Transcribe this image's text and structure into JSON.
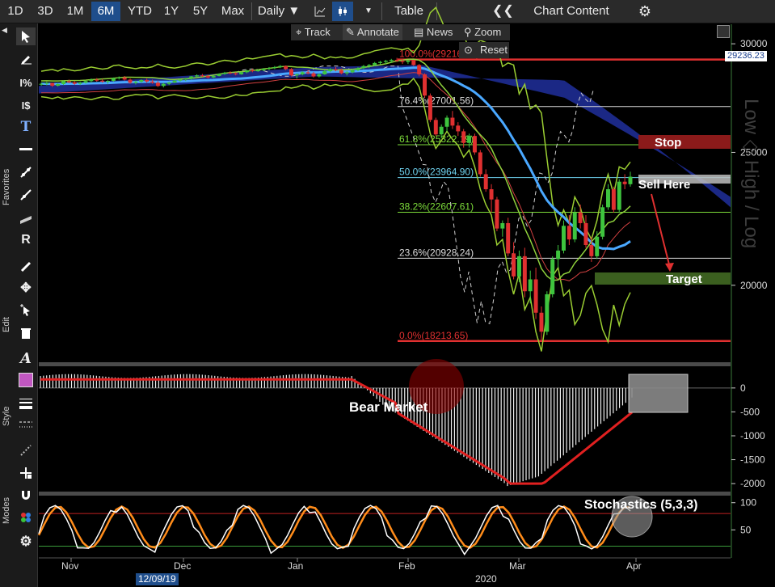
{
  "toolbar": {
    "periods": [
      "1D",
      "3D",
      "1M",
      "6M",
      "YTD",
      "1Y",
      "5Y",
      "Max"
    ],
    "active_period": "6M",
    "interval": "Daily ▼",
    "table_label": "Table",
    "chart_content_label": "Chart Content",
    "collapse_icon": "double-chevron-left-icon",
    "settings_icon": "gear-icon"
  },
  "subtoolbar": {
    "track": "Track",
    "annotate": "Annotate",
    "news": "News",
    "zoom": "Zoom",
    "reset": "Reset"
  },
  "sidebar": {
    "favorites_label": "Favorites",
    "edit_label": "Edit",
    "style_label": "Style",
    "modes_label": "Modes",
    "style_swatch_color": "#c157c1"
  },
  "watermark": "Low ◇ High / Log",
  "chart_data": [
    {
      "type": "candlestick",
      "title": "",
      "y_scale": "log",
      "y_ticks": [
        30000,
        25000,
        20000
      ],
      "ylim": [
        17600,
        31000
      ],
      "last_price": "29236.23",
      "x_months": [
        "Nov",
        "Dec",
        "Jan",
        "Feb",
        "Mar",
        "Apr"
      ],
      "x_year": "2020",
      "date_readout": "12/09/19",
      "fibonacci": [
        {
          "label": "100.0%(29216.15)",
          "value": 29216.15,
          "color": "#e03030"
        },
        {
          "label": "76.4%(27001.56)",
          "value": 27001.56,
          "color": "#dddddd"
        },
        {
          "label": "61.8%(25322.19)",
          "value": 25322.19,
          "color": "#7ddc3a"
        },
        {
          "label": "50.0%(23964.90)",
          "value": 23964.9,
          "color": "#6fd3f0"
        },
        {
          "label": "38.2%(22607.61)",
          "value": 22607.61,
          "color": "#7ddc3a"
        },
        {
          "label": "23.6%(20928.24)",
          "value": 20928.24,
          "color": "#dddddd"
        },
        {
          "label": "0.0%(18213.65)",
          "value": 18213.65,
          "color": "#e03030"
        }
      ],
      "annotations": [
        {
          "label": "Stop",
          "color": "#8b1a1a"
        },
        {
          "label": "Sell Here",
          "color": "#cfcfcf"
        },
        {
          "label": "Target",
          "color": "#3b5f1f"
        }
      ],
      "candles": [
        [
          28010,
          28110,
          27950,
          28050
        ],
        [
          28050,
          28150,
          27980,
          28090
        ],
        [
          28090,
          28100,
          27900,
          27960
        ],
        [
          27960,
          28070,
          27920,
          28040
        ],
        [
          28040,
          28200,
          28000,
          28170
        ],
        [
          28170,
          28250,
          28080,
          28120
        ],
        [
          28120,
          28180,
          28000,
          28050
        ],
        [
          28050,
          28150,
          27990,
          28100
        ],
        [
          28100,
          28210,
          28060,
          28180
        ],
        [
          28180,
          28300,
          28100,
          28250
        ],
        [
          28250,
          28320,
          28150,
          28200
        ],
        [
          28200,
          28280,
          28100,
          28150
        ],
        [
          28150,
          28220,
          28050,
          28190
        ],
        [
          28190,
          28350,
          28150,
          28320
        ],
        [
          28320,
          28400,
          28250,
          28350
        ],
        [
          28350,
          28420,
          28200,
          28250
        ],
        [
          28250,
          28300,
          28050,
          28100
        ],
        [
          28100,
          28200,
          28020,
          28150
        ],
        [
          28150,
          28260,
          28100,
          28230
        ],
        [
          28230,
          28300,
          28100,
          28160
        ],
        [
          28160,
          28250,
          28050,
          28100
        ],
        [
          28100,
          28180,
          27900,
          27950
        ],
        [
          27950,
          28100,
          27880,
          28050
        ],
        [
          28050,
          28150,
          27990,
          28110
        ],
        [
          28110,
          28230,
          28080,
          28200
        ],
        [
          28200,
          28300,
          28150,
          28250
        ],
        [
          28250,
          28330,
          28180,
          28300
        ],
        [
          28300,
          28420,
          28250,
          28400
        ],
        [
          28400,
          28500,
          28350,
          28450
        ],
        [
          28450,
          28520,
          28380,
          28420
        ],
        [
          28420,
          28480,
          28300,
          28350
        ],
        [
          28350,
          28450,
          28320,
          28420
        ],
        [
          28420,
          28550,
          28400,
          28520
        ],
        [
          28520,
          28620,
          28480,
          28580
        ],
        [
          28580,
          28650,
          28500,
          28550
        ],
        [
          28550,
          28600,
          28450,
          28500
        ],
        [
          28500,
          28620,
          28480,
          28600
        ],
        [
          28600,
          28720,
          28550,
          28690
        ],
        [
          28690,
          28760,
          28600,
          28650
        ],
        [
          28650,
          28750,
          28620,
          28700
        ],
        [
          28700,
          28800,
          28650,
          28760
        ],
        [
          28760,
          28850,
          28700,
          28800
        ],
        [
          28800,
          28900,
          28750,
          28850
        ],
        [
          28850,
          28950,
          28800,
          28900
        ],
        [
          28900,
          28920,
          28700,
          28750
        ],
        [
          28750,
          28800,
          28400,
          28450
        ],
        [
          28450,
          28550,
          28300,
          28500
        ],
        [
          28500,
          28650,
          28450,
          28600
        ],
        [
          28600,
          28700,
          28500,
          28550
        ],
        [
          28550,
          28620,
          28350,
          28400
        ],
        [
          28400,
          28550,
          28350,
          28500
        ],
        [
          28500,
          28700,
          28480,
          28650
        ],
        [
          28650,
          28800,
          28600,
          28750
        ],
        [
          28750,
          28850,
          28650,
          28700
        ],
        [
          28700,
          28780,
          28500,
          28550
        ],
        [
          28550,
          28650,
          28450,
          28600
        ],
        [
          28600,
          28750,
          28550,
          28700
        ],
        [
          28700,
          28850,
          28650,
          28800
        ],
        [
          28800,
          28950,
          28750,
          28900
        ],
        [
          28900,
          29000,
          28800,
          28950
        ],
        [
          28950,
          29100,
          28900,
          29050
        ],
        [
          29050,
          29150,
          28980,
          29100
        ],
        [
          29100,
          29200,
          29000,
          29150
        ],
        [
          29150,
          29250,
          29050,
          29200
        ],
        [
          29200,
          29300,
          29100,
          29150
        ],
        [
          29150,
          29250,
          29000,
          29100
        ],
        [
          29100,
          29200,
          29000,
          29180
        ],
        [
          29180,
          29200,
          28900,
          28950
        ],
        [
          28950,
          29000,
          28400,
          28500
        ],
        [
          28500,
          28550,
          27400,
          27500
        ],
        [
          27500,
          27600,
          26300,
          26400
        ],
        [
          26400,
          26500,
          25700,
          25766
        ],
        [
          25766,
          26200,
          25600,
          26100
        ],
        [
          26100,
          26600,
          25900,
          26500
        ],
        [
          26500,
          26800,
          26000,
          26150
        ],
        [
          26150,
          26300,
          25700,
          25900
        ],
        [
          25900,
          26000,
          25200,
          25400
        ],
        [
          25400,
          25800,
          25200,
          25700
        ],
        [
          25700,
          25800,
          24900,
          25000
        ],
        [
          25000,
          25100,
          24000,
          24100
        ],
        [
          24100,
          24300,
          23400,
          23500
        ],
        [
          23500,
          23700,
          22600,
          23100
        ],
        [
          23100,
          23200,
          21900,
          22000
        ],
        [
          22000,
          22300,
          21700,
          22200
        ],
        [
          22200,
          22400,
          21000,
          21100
        ],
        [
          21100,
          21500,
          20200,
          20300
        ],
        [
          20300,
          21200,
          20100,
          21000
        ],
        [
          21000,
          21300,
          19600,
          19800
        ],
        [
          19800,
          20500,
          19400,
          20200
        ],
        [
          20200,
          20600,
          18900,
          19100
        ],
        [
          19100,
          19300,
          18213,
          18500
        ],
        [
          18500,
          19800,
          18400,
          19700
        ],
        [
          19700,
          21000,
          19600,
          20900
        ],
        [
          20900,
          21400,
          20600,
          21200
        ],
        [
          21200,
          22300,
          21100,
          22100
        ],
        [
          22100,
          22500,
          21400,
          21600
        ],
        [
          21600,
          22800,
          21500,
          22600
        ],
        [
          22600,
          22900,
          22000,
          22200
        ],
        [
          22200,
          22500,
          21300,
          21400
        ],
        [
          21400,
          21700,
          20800,
          21000
        ],
        [
          21000,
          21900,
          20900,
          21700
        ],
        [
          21700,
          22900,
          21600,
          22800
        ],
        [
          22800,
          23700,
          22700,
          23500
        ],
        [
          23500,
          23600,
          22600,
          22700
        ],
        [
          22700,
          23900,
          22600,
          23800
        ],
        [
          23800,
          24100,
          23500,
          23700
        ],
        [
          23700,
          24200,
          23600,
          24000
        ]
      ]
    },
    {
      "type": "histogram",
      "title": "",
      "annotation": "Bear Market",
      "y_ticks": [
        0,
        -500,
        -1000,
        -1500,
        -2000
      ],
      "ylim": [
        -2150,
        420
      ]
    },
    {
      "type": "line",
      "title": "Stochastics (5,3,3)",
      "y_ticks": [
        100,
        50
      ],
      "ylim": [
        0,
        110
      ],
      "levels": [
        80,
        20
      ]
    }
  ]
}
